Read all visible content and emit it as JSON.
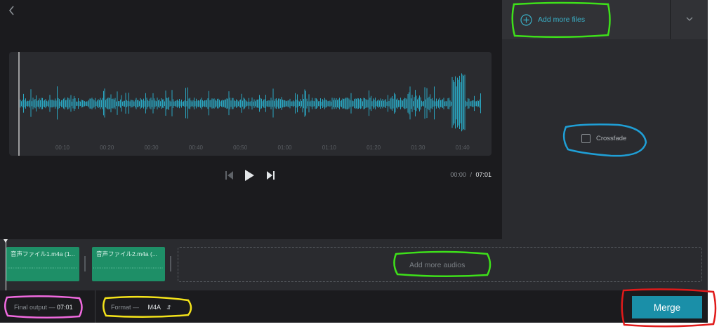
{
  "editor": {
    "time_markers": [
      "00:10",
      "00:20",
      "00:30",
      "00:40",
      "00:50",
      "01:00",
      "01:10",
      "01:20",
      "01:30",
      "01:40"
    ],
    "current_time": "00:00",
    "separator": "/",
    "total_time": "07:01"
  },
  "side": {
    "add_files_label": "Add more files",
    "crossfade_label": "Crossfade",
    "crossfade_checked": false
  },
  "timeline": {
    "clips": [
      {
        "name": "音声ファイル1.m4a (1..."
      },
      {
        "name": "音声ファイル2.m4a (..."
      }
    ],
    "add_audios_label": "Add more audios"
  },
  "footer": {
    "final_output_label": "Final output —",
    "final_output_value": "07:01",
    "format_label": "Format —",
    "format_value": "M4A",
    "merge_label": "Merge"
  },
  "colors": {
    "background": "#1b1b1e",
    "panel": "#2a2b2f",
    "waveform": "#2aa6c0",
    "clip": "#1e8f67",
    "accent": "#1a8fa8",
    "add_files_text": "#3ab0c7"
  },
  "icons": {
    "back": "chevron-left-icon",
    "add_files": "plus-circle-icon",
    "dropdown": "chevron-down-icon",
    "skip_back": "skip-back-icon",
    "play": "play-icon",
    "skip_forward": "skip-forward-icon",
    "format_select": "updown-arrows-icon"
  }
}
